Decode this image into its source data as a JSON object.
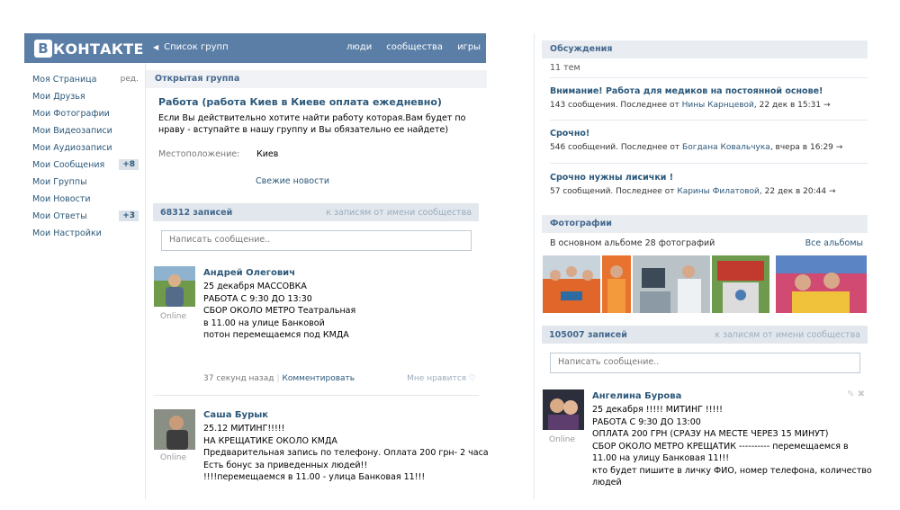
{
  "header": {
    "logo_letter": "B",
    "logo_text": "КОНТАКТЕ",
    "back_link": "Список групп",
    "nav": [
      "люди",
      "сообщества",
      "игры"
    ]
  },
  "sidebar": {
    "items": [
      {
        "label": "Моя Страница",
        "extra": "ред."
      },
      {
        "label": "Мои Друзья"
      },
      {
        "label": "Мои Фотографии"
      },
      {
        "label": "Мои Видеозаписи"
      },
      {
        "label": "Мои Аудиозаписи"
      },
      {
        "label": "Мои Сообщения",
        "badge": "+8"
      },
      {
        "label": "Мои Группы"
      },
      {
        "label": "Мои Новости"
      },
      {
        "label": "Мои Ответы",
        "badge": "+3"
      },
      {
        "label": "Мои Настройки"
      }
    ]
  },
  "group": {
    "type": "Открытая группа",
    "title": "Работа (работа Киев в Киеве оплата ежедневно)",
    "description": "Если Вы действительно хотите найти работу которая.Вам будет по нраву - вступайте в нашу группу и Вы обязательно ее найдете)",
    "location_label": "Местоположение:",
    "location_value": "Киев",
    "fresh_news": "Свежие новости"
  },
  "wall_left": {
    "count": "68312 записей",
    "on_behalf": "к записям от имени сообщества",
    "input_placeholder": "Написать сообщение..",
    "posts": [
      {
        "author": "Андрей Олегович",
        "online": "Online",
        "text": "25 декабря МАССОВКА\nРАБОТА С 9:30 ДО 13:30\nСБОР ОКОЛО МЕТРО Театральная\nв 11.00 на улице Банковой\nпотон перемещаемся под КМДА",
        "time": "37 секунд назад",
        "comment": "Комментировать",
        "like": "Мне нравится ♡"
      },
      {
        "author": "Саша Бурык",
        "online": "Online",
        "text": "25.12 МИТИНГ!!!!!\nНА КРЕЩАТИКЕ ОКОЛО КМДА\nПредварительная запись по телефону. Оплата 200 грн- 2 часа\nЕсть бонус за приведенных людей!!\n!!!!перемещаемся в 11.00 - улица Банковая 11!!!"
      }
    ]
  },
  "discussions": {
    "title": "Обсуждения",
    "count": "11 тем",
    "topics": [
      {
        "title": "Внимание! Работа для медиков на постоянной основе!",
        "meta_pre": "143 сообщения. Последнее от ",
        "who": "Нины Карнцевой",
        "meta_post": ", 22 дек в 15:31 →"
      },
      {
        "title": "Срочно!",
        "meta_pre": "546 сообщений. Последнее от ",
        "who": "Богдана Ковальчука",
        "meta_post": ", вчера в 16:29 →"
      },
      {
        "title": "Срочно нужны лисички !",
        "meta_pre": "57 сообщений. Последнее от ",
        "who": "Карины Филатовой",
        "meta_post": ", 22 дек в 20:44 →"
      }
    ]
  },
  "photos": {
    "title": "Фотографии",
    "subtitle": "В основном альбоме 28 фотографий",
    "all_albums": "Все альбомы"
  },
  "wall_right": {
    "count": "105007 записей",
    "on_behalf": "к записям от имени сообщества",
    "input_placeholder": "Написать сообщение..",
    "post": {
      "author": "Ангелина Бурова",
      "online": "Online",
      "text": "25 декабря !!!!! МИТИНГ !!!!!\nРАБОТА С 9:30 ДО 13:00\nОПЛАТА 200 ГРН (СРАЗУ НА МЕСТЕ ЧЕРЕЗ 15 МИНУТ)\nСБОР ОКОЛО МЕТРО КРЕЩАТИК ---------- перемещаемся в\n11.00 на улицу Банковая 11!!!\nкто будет пишите в личку ФИО, номер телефона, количество\nлюдей"
    }
  },
  "colors": {
    "header_bg": "#5b7ea6",
    "link": "#2b587a",
    "bar_bg": "#e1e7ed"
  }
}
